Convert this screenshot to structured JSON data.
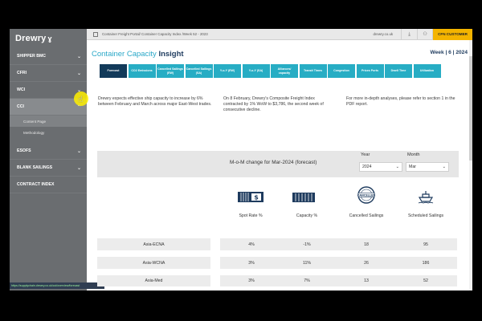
{
  "sidebar": {
    "brand": "Drewry",
    "items": [
      {
        "label": "SHIPPER BMC",
        "chevron": true
      },
      {
        "label": "CFRI",
        "chevron": true
      },
      {
        "label": "WCI",
        "chevron": true
      },
      {
        "label": "CCI",
        "chevron": true,
        "active": true
      },
      {
        "label": "ESOFS",
        "chevron": true
      },
      {
        "label": "BLANK SAILINGS",
        "chevron": true
      },
      {
        "label": "CONTRACT INDEX",
        "chevron": false
      }
    ],
    "sub_items": [
      {
        "label": "Content Page",
        "active": true
      },
      {
        "label": "Methodology",
        "active": false
      }
    ]
  },
  "statusbar": "https://supplychain.drewry.co.uk/cci/overview/forecast",
  "topbar": {
    "breadcrumb": "Container Freight Portal/ Container Capacity Index /Week 52 - 2023",
    "site": "drewry.co.uk",
    "download_icon": "download-icon",
    "user_icon": "user-icon",
    "customer_label": "CFN CUSTOMER"
  },
  "header": {
    "title_main": "Container Capacity ",
    "title_bold": "Insight",
    "week": "Week | 6 | 2024"
  },
  "tabs": [
    {
      "label": "Forecast",
      "selected": true
    },
    {
      "label": "CO2 Emissions"
    },
    {
      "label": "Cancelled Sailings (EW)"
    },
    {
      "label": "Cancelled Sailings (SA)"
    },
    {
      "label": "Y-o-Y (EW)"
    },
    {
      "label": "Y-o-Y (SA)"
    },
    {
      "label": "Alliances/ capacity"
    },
    {
      "label": "Transit Times"
    },
    {
      "label": "Congestion"
    },
    {
      "label": "Prices Ports"
    },
    {
      "label": "Dwell Time"
    },
    {
      "label": "Utilization"
    }
  ],
  "paragraphs": [
    "Drewry expects effective ship capacity to increase by 6% between February and March across major East-West trades.",
    "On 8 February, Drewry's Composite Freight Index contracted by 1% WoW to $3,786, the second week of consecutive decline.",
    "For more in-depth analyses, please refer to section 1 in the PDF report."
  ],
  "mom": {
    "title": "M-o-M change for Mar-2024 (forecast)",
    "year_label": "Year",
    "year_value": "2024",
    "month_label": "Month",
    "month_value": "Mar"
  },
  "columns": [
    {
      "label": "Spot Rate %",
      "icon": "dollar-container-icon"
    },
    {
      "label": "Capacity %",
      "icon": "container-icon"
    },
    {
      "label": "Cancelled Sailings",
      "icon": "cancelled-stamp-icon"
    },
    {
      "label": "Scheduled Sailings",
      "icon": "ship-icon"
    }
  ],
  "rows": [
    {
      "label": "Asia-ECNA",
      "values": [
        "4%",
        "-1%",
        "18",
        "95"
      ]
    },
    {
      "label": "Asia-WCNA",
      "values": [
        "3%",
        "11%",
        "26",
        "186"
      ]
    },
    {
      "label": "Asia-Med",
      "values": [
        "3%",
        "7%",
        "13",
        "52"
      ]
    }
  ],
  "colors": {
    "accent": "#27adc4",
    "navy": "#123a5a",
    "sidebar": "#6a6d70",
    "customer": "#f4b400"
  }
}
